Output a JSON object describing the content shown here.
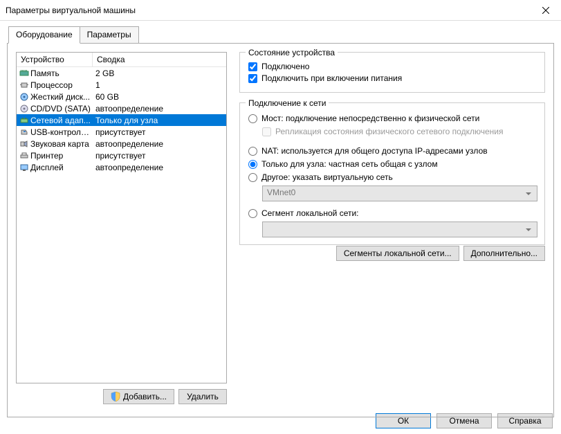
{
  "window": {
    "title": "Параметры виртуальной машины"
  },
  "tabs": {
    "hardware": "Оборудование",
    "options": "Параметры"
  },
  "device_table": {
    "header_device": "Устройство",
    "header_summary": "Сводка",
    "rows": [
      {
        "name": "Память",
        "summary": "2 GB"
      },
      {
        "name": "Процессор",
        "summary": "1"
      },
      {
        "name": "Жесткий диск...",
        "summary": "60 GB"
      },
      {
        "name": "CD/DVD (SATA)",
        "summary": "автоопределение"
      },
      {
        "name": "Сетевой адап...",
        "summary": "Только для узла"
      },
      {
        "name": "USB-контроллер",
        "summary": "присутствует"
      },
      {
        "name": "Звуковая карта",
        "summary": "автоопределение"
      },
      {
        "name": "Принтер",
        "summary": "присутствует"
      },
      {
        "name": "Дисплей",
        "summary": "автоопределение"
      }
    ]
  },
  "buttons": {
    "add": "Добавить...",
    "remove": "Удалить",
    "ok": "ОК",
    "cancel": "Отмена",
    "help": "Справка",
    "lan_segments": "Сегменты локальной сети...",
    "advanced": "Дополнительно..."
  },
  "device_status": {
    "title": "Состояние устройства",
    "connected": "Подключено",
    "connect_at_power": "Подключить при включении питания"
  },
  "network": {
    "title": "Подключение к сети",
    "bridged": "Мост: подключение непосредственно к физической сети",
    "replicate": "Репликация состояния физического сетевого подключения",
    "nat": "NAT: используется для общего доступа IP-адресами узлов",
    "host_only": "Только для узла: частная сеть общая с узлом",
    "custom": "Другое: указать виртуальную сеть",
    "custom_value": "VMnet0",
    "lan_segment": "Сегмент локальной сети:",
    "lan_value": ""
  }
}
